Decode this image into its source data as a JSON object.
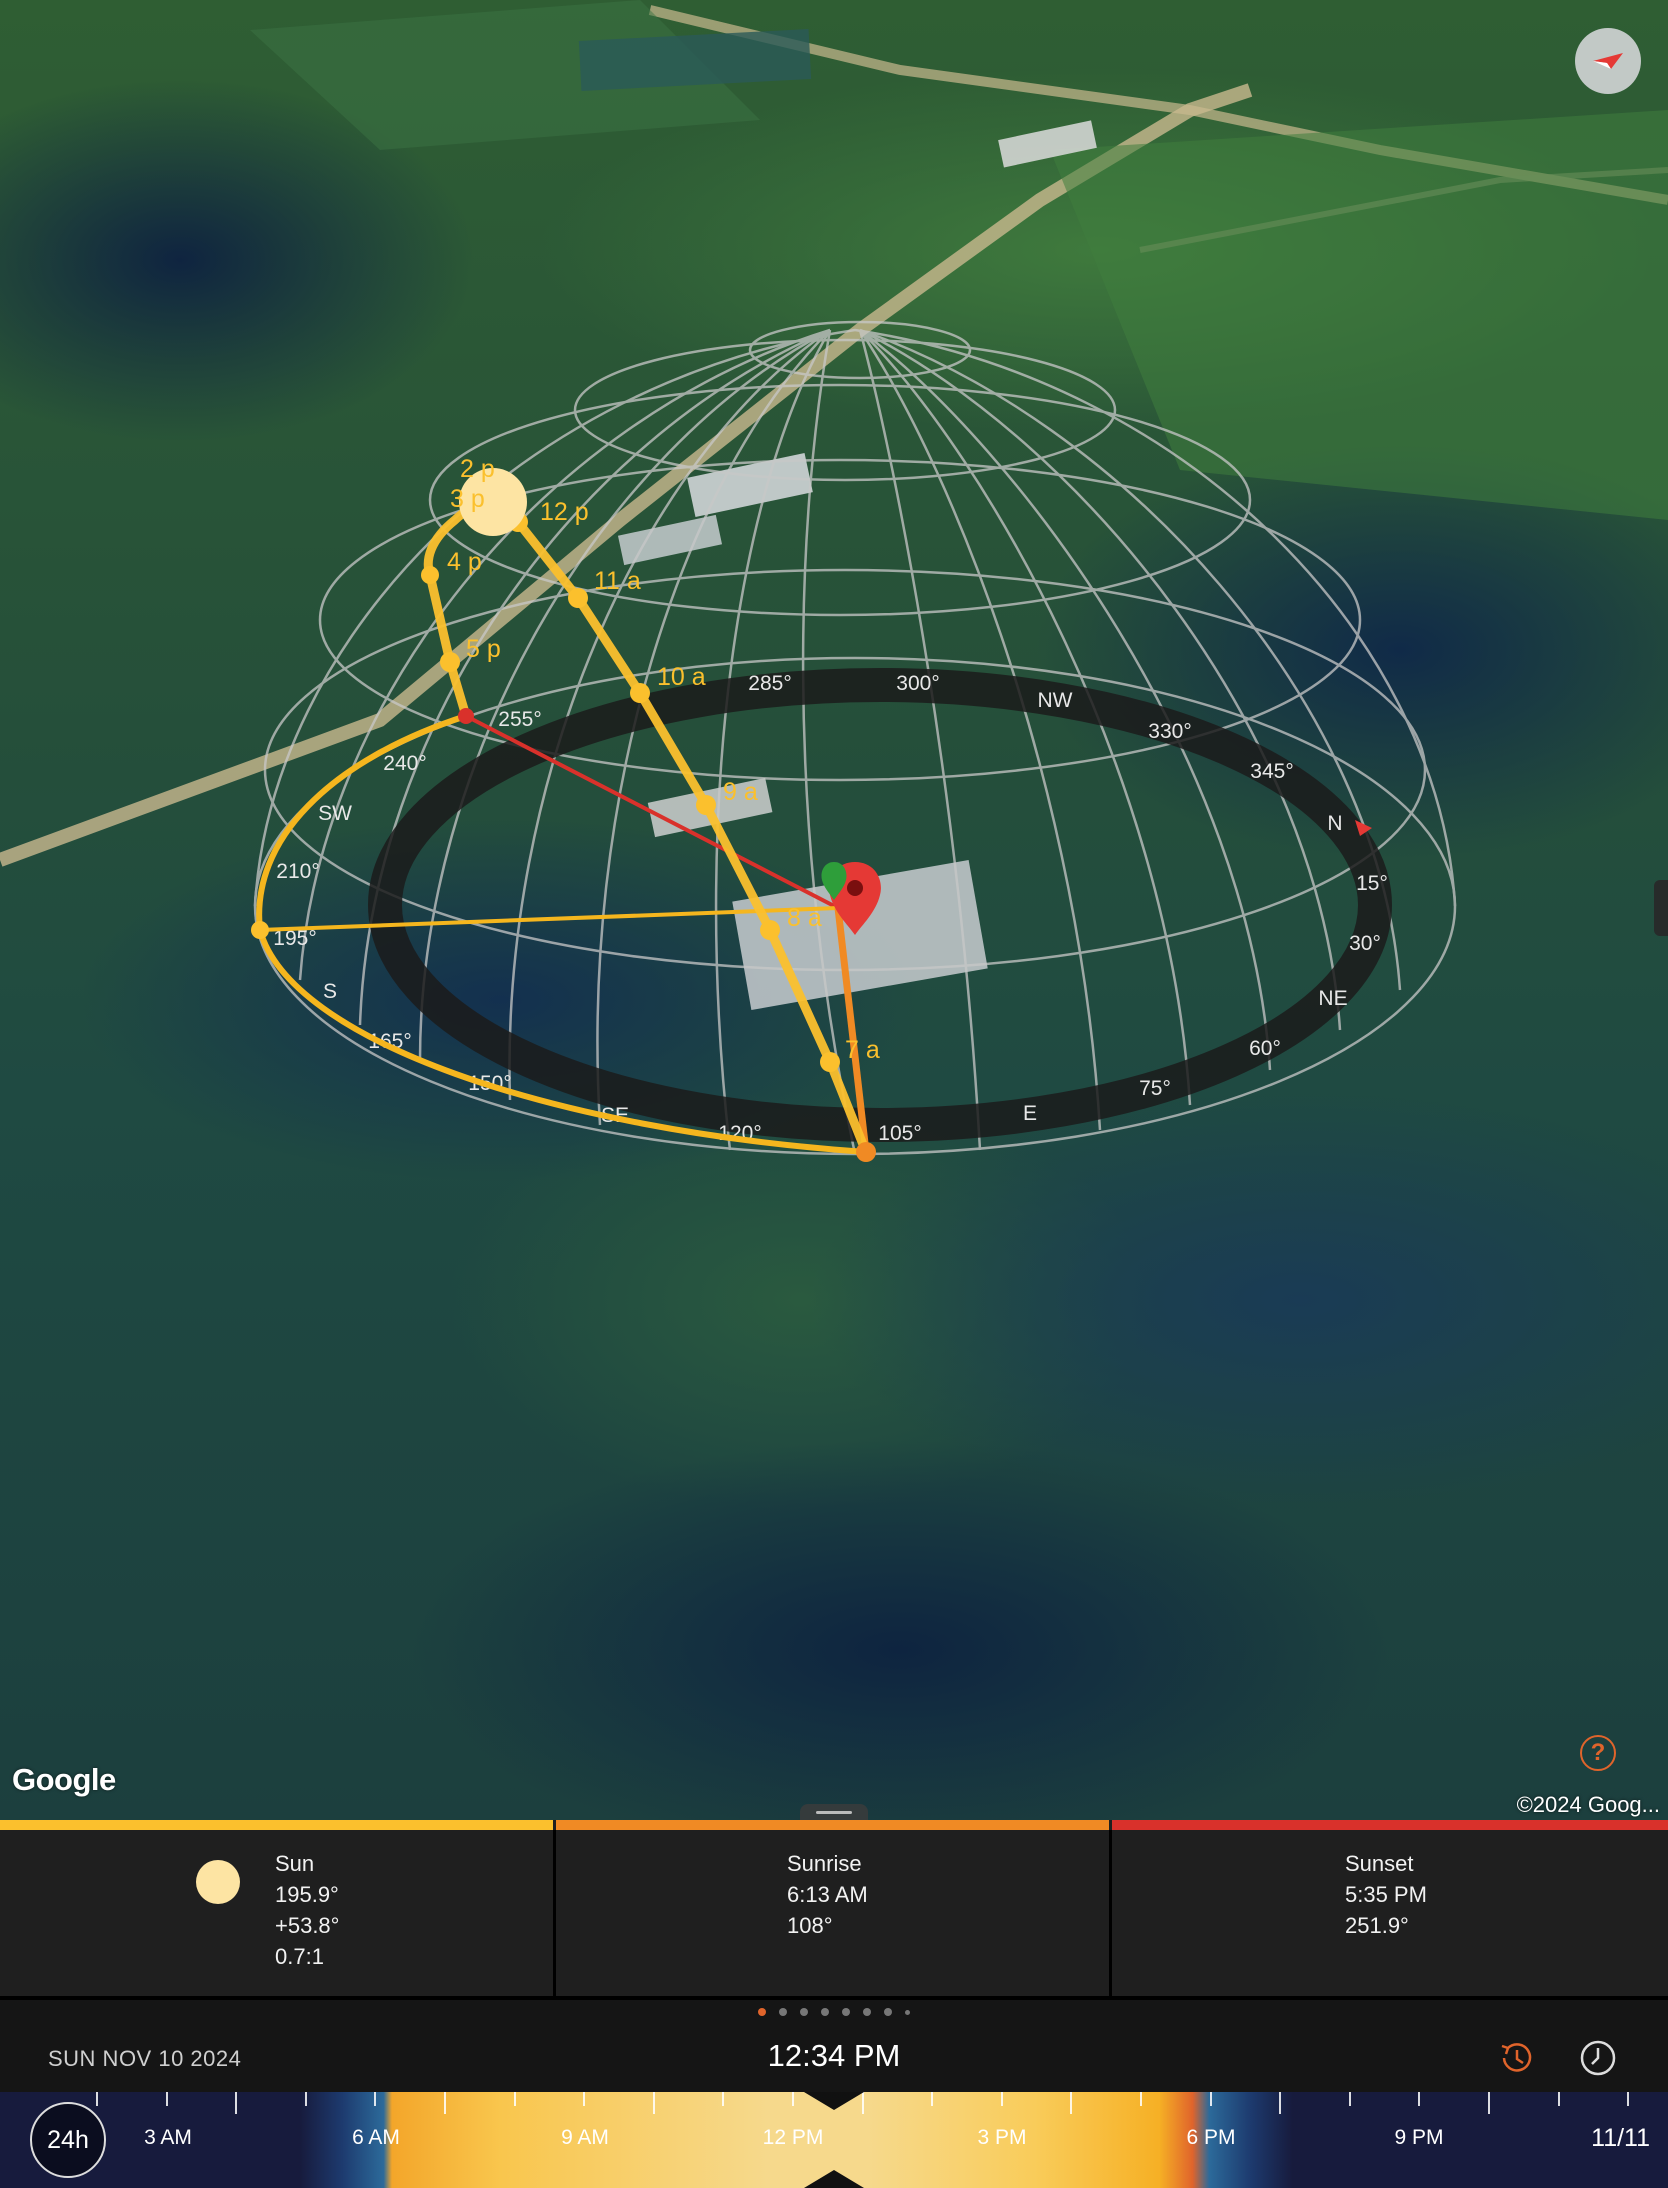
{
  "map": {
    "attribution_logo": "Google",
    "copyright": "©2024 Goog...",
    "help_label": "?",
    "compass_button_icon": "compass-arrow-icon",
    "sun_path_labels": [
      "3 p",
      "12 p",
      "4 p",
      "11 a",
      "5 p",
      "10 a",
      "9 a",
      "8 a",
      "7 a",
      "2 p"
    ],
    "ring_labels": [
      "285°",
      "300°",
      "NW",
      "330°",
      "345°",
      "N",
      "15°",
      "30°",
      "NE",
      "60°",
      "75°",
      "E",
      "105°",
      "120°",
      "SE",
      "150°",
      "165°",
      "S",
      "195°",
      "210°",
      "SW",
      "240°",
      "255°"
    ],
    "colors": {
      "sun": "#fbc02d",
      "sunrise": "#f08a24",
      "sunset": "#d9312b",
      "pin": "#e53935",
      "pin_green": "#2e9e3a"
    }
  },
  "panel": {
    "colors": {
      "sun_bar": "#fbc02d",
      "sunrise_bar": "#f08a24",
      "sunset_bar": "#d9312b"
    },
    "sun": {
      "title": "Sun",
      "azimuth": "195.9°",
      "elevation": "+53.8°",
      "shadow_ratio": "0.7:1"
    },
    "sunrise": {
      "title": "Sunrise",
      "time": "6:13 AM",
      "azimuth": "108°"
    },
    "sunset": {
      "title": "Sunset",
      "time": "5:35 PM",
      "azimuth": "251.9°"
    }
  },
  "page_indicator": {
    "total": 8,
    "active": 0
  },
  "info_bar": {
    "date": "SUN NOV 10 2024",
    "time": "12:34 PM",
    "history_icon": "history-clock-icon",
    "clock_icon": "clock-icon"
  },
  "timeline": {
    "mode_button": "24h",
    "labels": [
      "3 AM",
      "6 AM",
      "9 AM",
      "12 PM",
      "3 PM",
      "6 PM",
      "9 PM"
    ],
    "end_date": "11/11"
  }
}
